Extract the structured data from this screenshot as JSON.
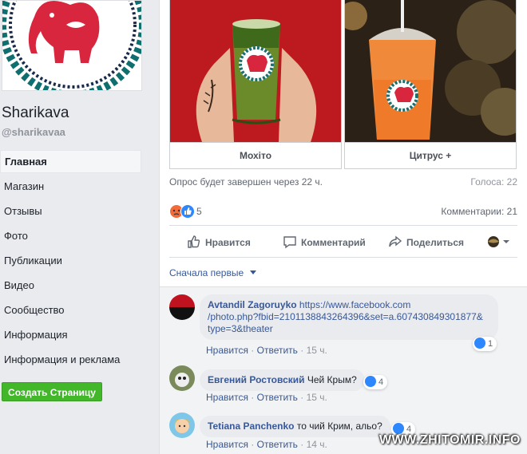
{
  "page": {
    "name": "Sharikava",
    "handle": "@sharikavaa"
  },
  "nav": {
    "items": [
      {
        "label": "Главная",
        "active": true
      },
      {
        "label": "Магазин"
      },
      {
        "label": "Отзывы"
      },
      {
        "label": "Фото"
      },
      {
        "label": "Публикации"
      },
      {
        "label": "Видео"
      },
      {
        "label": "Сообщество"
      },
      {
        "label": "Информация"
      },
      {
        "label": "Информация и реклама"
      }
    ],
    "create_page": "Создать Страницу"
  },
  "poll": {
    "options": [
      {
        "label": "Мохіто"
      },
      {
        "label": "Цитрус +"
      }
    ],
    "ends_text": "Опрос будет завершен через 22 ч.",
    "votes_text": "Голоса: 22"
  },
  "reactions": {
    "count": "5",
    "comments_text": "Комментарии: 21"
  },
  "actions": {
    "like": "Нравится",
    "comment": "Комментарий",
    "share": "Поделиться"
  },
  "sort": {
    "label": "Сначала первые"
  },
  "comments": [
    {
      "author": "Avtandil Zagoruyko",
      "line1": "https://www.facebook.com",
      "line2": "/photo.php?fbid=2101138843264396&set=a.607430849301877&",
      "line3": "type=3&theater",
      "like": "Нравится",
      "reply": "Ответить",
      "time": "15 ч.",
      "likes": "1"
    },
    {
      "author": "Евгений Ростовский",
      "text": "Чей Крым?",
      "like": "Нравится",
      "reply": "Ответить",
      "time": "15 ч.",
      "likes": "4"
    },
    {
      "author": "Tetiana Panchenko",
      "text": "то чий Крим, альо?",
      "like": "Нравится",
      "reply": "Ответить",
      "time": "14 ч.",
      "likes": "4"
    }
  ],
  "watermark": "WWW.ZHITOMIR.INFO",
  "colors": {
    "link": "#385898",
    "create_button": "#42b72a",
    "like_blue": "#2d88ff",
    "logo_red": "#d7263d"
  }
}
